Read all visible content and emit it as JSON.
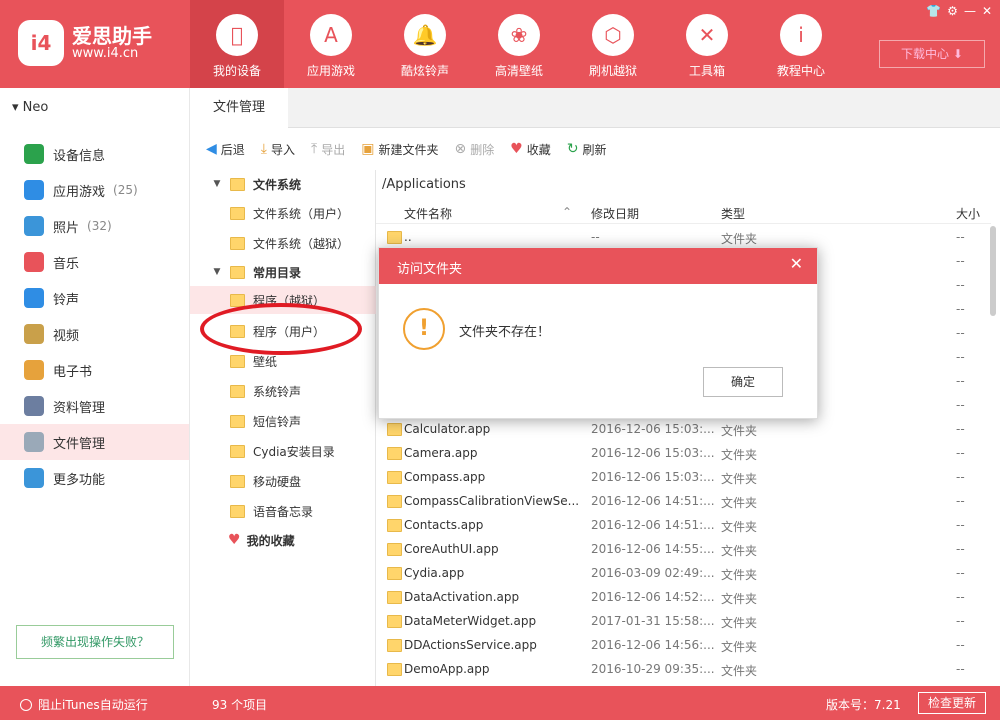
{
  "app": {
    "name": "爱思助手",
    "url": "www.i4.cn",
    "logo_text": "i4"
  },
  "nav": [
    {
      "label": "我的设备",
      "icon": "apple-icon",
      "glyph": "",
      "active": true
    },
    {
      "label": "应用游戏",
      "icon": "appstore-icon",
      "glyph": "A"
    },
    {
      "label": "酷炫铃声",
      "icon": "bell-icon",
      "glyph": "🔔"
    },
    {
      "label": "高清壁纸",
      "icon": "flower-icon",
      "glyph": "❀"
    },
    {
      "label": "刷机越狱",
      "icon": "box-icon",
      "glyph": "⬡"
    },
    {
      "label": "工具箱",
      "icon": "tools-icon",
      "glyph": "✕"
    },
    {
      "label": "教程中心",
      "icon": "info-icon",
      "glyph": "i"
    }
  ],
  "download_center": "下载中心",
  "device": {
    "name": "Neo"
  },
  "sidebar": {
    "items": [
      {
        "label": "设备信息",
        "icon": "info-icon",
        "color": "#2ba24c"
      },
      {
        "label": "应用游戏",
        "icon": "appstore-icon",
        "color": "#2f8de4",
        "count": "(25)"
      },
      {
        "label": "照片",
        "icon": "photo-icon",
        "color": "#3b95d9",
        "count": "(32)"
      },
      {
        "label": "音乐",
        "icon": "music-icon",
        "color": "#e8535a"
      },
      {
        "label": "铃声",
        "icon": "bell-icon",
        "color": "#2f8de4"
      },
      {
        "label": "视频",
        "icon": "video-icon",
        "color": "#c9a04a"
      },
      {
        "label": "电子书",
        "icon": "book-icon",
        "color": "#e6a23c"
      },
      {
        "label": "资料管理",
        "icon": "contacts-icon",
        "color": "#6c7ea0"
      },
      {
        "label": "文件管理",
        "icon": "file-icon",
        "color": "#9aa9b8",
        "active": true
      },
      {
        "label": "更多功能",
        "icon": "grid-icon",
        "color": "#3b95d9"
      }
    ],
    "help_button": "频繁出现操作失败？"
  },
  "tabs": {
    "file_manager": "文件管理"
  },
  "toolbar": {
    "back": "后退",
    "import": "导入",
    "export": "导出",
    "new_folder": "新建文件夹",
    "delete": "删除",
    "favorite": "收藏",
    "refresh": "刷新"
  },
  "tree": {
    "filesystem": "文件系统",
    "filesystem_user": "文件系统（用户）",
    "filesystem_jailbreak": "文件系统（越狱）",
    "common": "常用目录",
    "programs_jailbreak": "程序（越狱）",
    "programs_user": "程序（用户）",
    "wallpaper": "壁纸",
    "system_ringtones": "系统铃声",
    "sms_ringtones": "短信铃声",
    "cydia_dir": "Cydia安装目录",
    "usb_drive": "移动硬盘",
    "voice_memos": "语音备忘录",
    "favorites": "我的收藏"
  },
  "path": "/Applications",
  "columns": {
    "name": "文件名称",
    "date": "修改日期",
    "type": "类型",
    "size": "大小"
  },
  "files": [
    {
      "name": "..",
      "date": "--",
      "type": "文件夹",
      "size": "--"
    },
    {
      "name": "",
      "date": "",
      "type": "",
      "size": "--"
    },
    {
      "name": "",
      "date": "",
      "type": "",
      "size": "--"
    },
    {
      "name": "",
      "date": "",
      "type": "",
      "size": "--"
    },
    {
      "name": "",
      "date": "",
      "type": "",
      "size": "--"
    },
    {
      "name": "",
      "date": "",
      "type": "",
      "size": "--"
    },
    {
      "name": "",
      "date": "",
      "type": "",
      "size": "--"
    },
    {
      "name": "",
      "date": "",
      "type": "",
      "size": "--"
    },
    {
      "name": "Calculator.app",
      "date": "2016-12-06 15:03:...",
      "type": "文件夹",
      "size": "--"
    },
    {
      "name": "Camera.app",
      "date": "2016-12-06 15:03:...",
      "type": "文件夹",
      "size": "--"
    },
    {
      "name": "Compass.app",
      "date": "2016-12-06 15:03:...",
      "type": "文件夹",
      "size": "--"
    },
    {
      "name": "CompassCalibrationViewSe...",
      "date": "2016-12-06 14:51:...",
      "type": "文件夹",
      "size": "--"
    },
    {
      "name": "Contacts.app",
      "date": "2016-12-06 14:51:...",
      "type": "文件夹",
      "size": "--"
    },
    {
      "name": "CoreAuthUI.app",
      "date": "2016-12-06 14:55:...",
      "type": "文件夹",
      "size": "--"
    },
    {
      "name": "Cydia.app",
      "date": "2016-03-09 02:49:...",
      "type": "文件夹",
      "size": "--"
    },
    {
      "name": "DataActivation.app",
      "date": "2016-12-06 14:52:...",
      "type": "文件夹",
      "size": "--"
    },
    {
      "name": "DataMeterWidget.app",
      "date": "2017-01-31 15:58:...",
      "type": "文件夹",
      "size": "--"
    },
    {
      "name": "DDActionsService.app",
      "date": "2016-12-06 14:56:...",
      "type": "文件夹",
      "size": "--"
    },
    {
      "name": "DemoApp.app",
      "date": "2016-10-29 09:35:...",
      "type": "文件夹",
      "size": "--"
    }
  ],
  "status": {
    "itunes_toggle": "阻止iTunes自动运行",
    "item_count": "93 个项目",
    "version": "版本号：7.21",
    "check_update": "检查更新"
  },
  "dialog": {
    "title": "访问文件夹",
    "message": "文件夹不存在！",
    "ok": "确定"
  },
  "colors": {
    "brand": "#e8535a",
    "dialog_warning": "#f0a030",
    "annotation": "#e01b24"
  }
}
